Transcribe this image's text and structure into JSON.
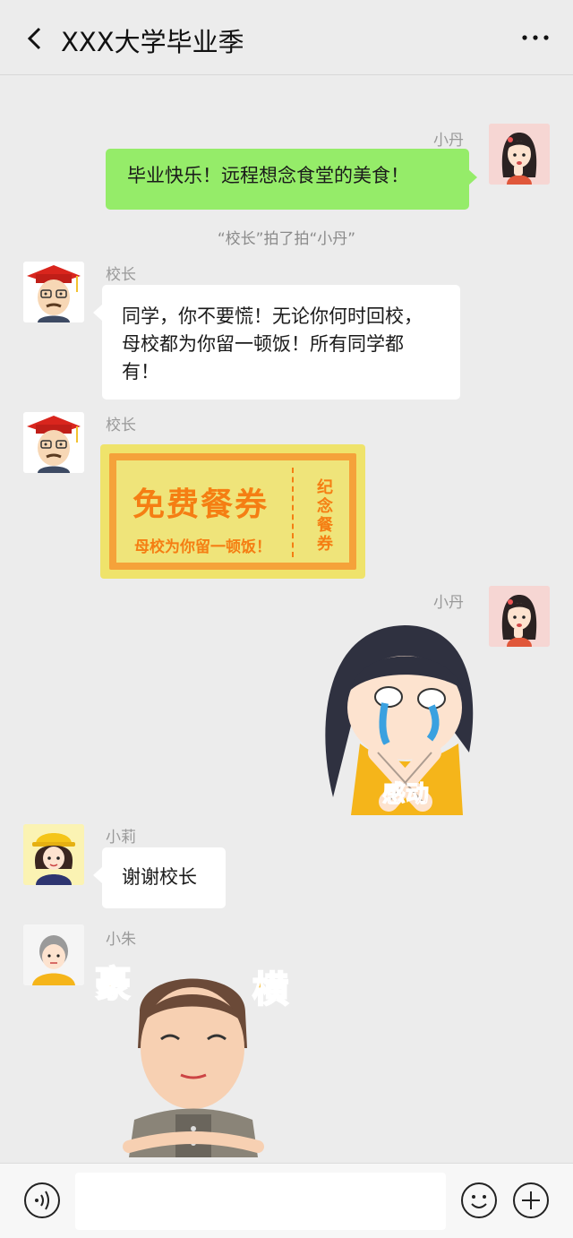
{
  "header": {
    "title": "XXX大学毕业季",
    "back_icon": "chevron-left-icon",
    "more_icon": "more-dots-icon"
  },
  "messages": [
    {
      "sender": "小丹",
      "side": "right",
      "type": "text",
      "text": "毕业快乐！远程想念食堂的美食！"
    },
    {
      "type": "system",
      "text": "“校长”拍了拍“小丹”"
    },
    {
      "sender": "校长",
      "side": "left",
      "type": "text",
      "lines": [
        "同学，你不要慌！无论你何时回校，",
        "母校都为你留一顿饭！所有同学都",
        "有！"
      ]
    },
    {
      "sender": "校长",
      "side": "left",
      "type": "coupon",
      "coupon": {
        "title": "免费餐券",
        "subtitle": "母校为你留一顿饭！",
        "side": [
          "纪",
          "念",
          "餐",
          "券"
        ]
      }
    },
    {
      "sender": "小丹",
      "side": "right",
      "type": "sticker",
      "sticker_text": "感动"
    },
    {
      "sender": "小莉",
      "side": "left",
      "type": "text",
      "text": "谢谢校长"
    },
    {
      "sender": "小朱",
      "side": "left",
      "type": "sticker",
      "sticker_text": [
        "豪",
        "横"
      ]
    }
  ],
  "input_bar": {
    "voice_icon": "voice-icon",
    "emoji_icon": "emoji-icon",
    "add_icon": "plus-icon",
    "placeholder": ""
  },
  "colors": {
    "background": "#ececec",
    "my_bubble": "#95ec69",
    "other_bubble": "#ffffff",
    "coupon_orange": "#f57e13",
    "coupon_yellow": "#efe47a"
  }
}
